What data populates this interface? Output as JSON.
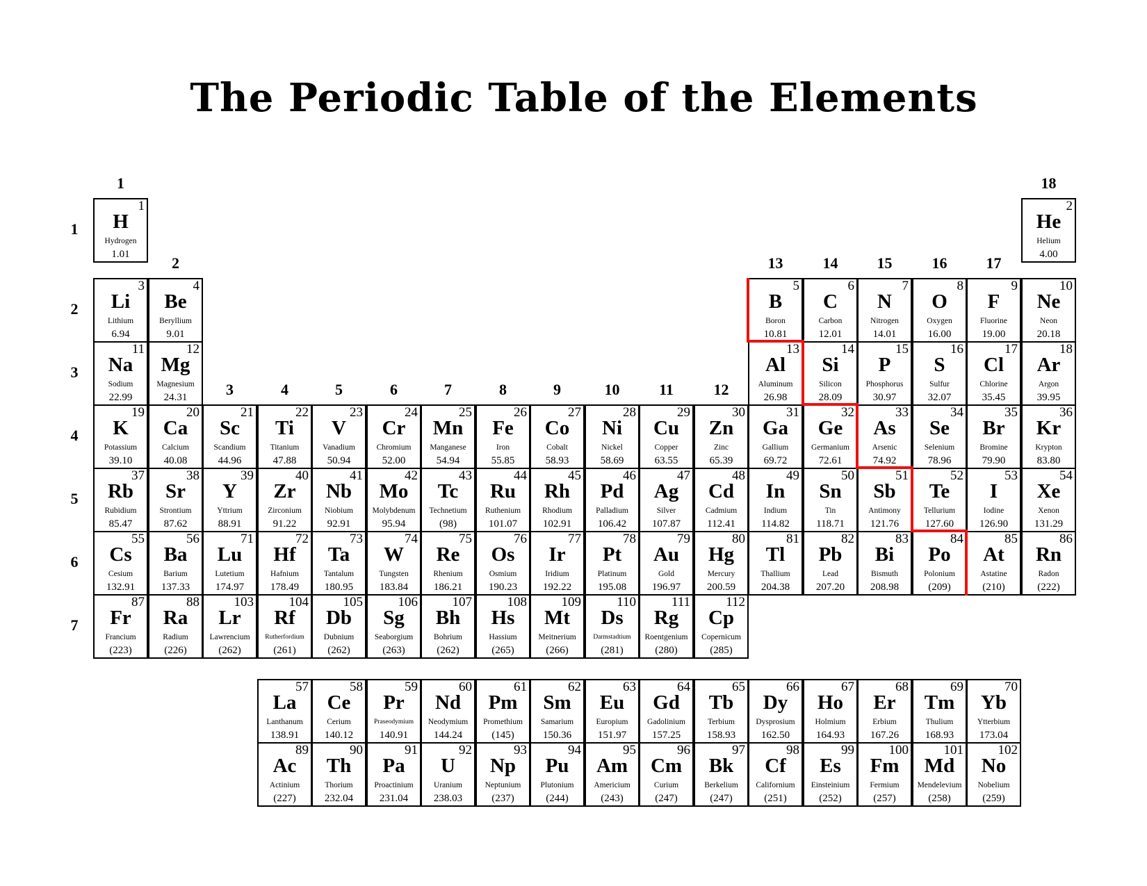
{
  "title": "The Periodic Table of the Elements",
  "colors": {
    "staircase_line": "#ee1111"
  },
  "group_labels": [
    "1",
    "2",
    "3",
    "4",
    "5",
    "6",
    "7",
    "8",
    "9",
    "10",
    "11",
    "12",
    "13",
    "14",
    "15",
    "16",
    "17",
    "18"
  ],
  "period_labels": [
    "1",
    "2",
    "3",
    "4",
    "5",
    "6",
    "7"
  ],
  "elements": [
    {
      "n": "1",
      "s": "H",
      "name": "Hydrogen",
      "w": "1.01"
    },
    {
      "n": "2",
      "s": "He",
      "name": "Helium",
      "w": "4.00"
    },
    {
      "n": "3",
      "s": "Li",
      "name": "Lithium",
      "w": "6.94"
    },
    {
      "n": "4",
      "s": "Be",
      "name": "Beryllium",
      "w": "9.01"
    },
    {
      "n": "5",
      "s": "B",
      "name": "Boron",
      "w": "10.81"
    },
    {
      "n": "6",
      "s": "C",
      "name": "Carbon",
      "w": "12.01"
    },
    {
      "n": "7",
      "s": "N",
      "name": "Nitrogen",
      "w": "14.01"
    },
    {
      "n": "8",
      "s": "O",
      "name": "Oxygen",
      "w": "16.00"
    },
    {
      "n": "9",
      "s": "F",
      "name": "Fluorine",
      "w": "19.00"
    },
    {
      "n": "10",
      "s": "Ne",
      "name": "Neon",
      "w": "20.18"
    },
    {
      "n": "11",
      "s": "Na",
      "name": "Sodium",
      "w": "22.99"
    },
    {
      "n": "12",
      "s": "Mg",
      "name": "Magnesium",
      "w": "24.31"
    },
    {
      "n": "13",
      "s": "Al",
      "name": "Aluminum",
      "w": "26.98"
    },
    {
      "n": "14",
      "s": "Si",
      "name": "Silicon",
      "w": "28.09"
    },
    {
      "n": "15",
      "s": "P",
      "name": "Phosphorus",
      "w": "30.97"
    },
    {
      "n": "16",
      "s": "S",
      "name": "Sulfur",
      "w": "32.07"
    },
    {
      "n": "17",
      "s": "Cl",
      "name": "Chlorine",
      "w": "35.45"
    },
    {
      "n": "18",
      "s": "Ar",
      "name": "Argon",
      "w": "39.95"
    },
    {
      "n": "19",
      "s": "K",
      "name": "Potassium",
      "w": "39.10"
    },
    {
      "n": "20",
      "s": "Ca",
      "name": "Calcium",
      "w": "40.08"
    },
    {
      "n": "21",
      "s": "Sc",
      "name": "Scandium",
      "w": "44.96"
    },
    {
      "n": "22",
      "s": "Ti",
      "name": "Titanium",
      "w": "47.88"
    },
    {
      "n": "23",
      "s": "V",
      "name": "Vanadium",
      "w": "50.94"
    },
    {
      "n": "24",
      "s": "Cr",
      "name": "Chromium",
      "w": "52.00"
    },
    {
      "n": "25",
      "s": "Mn",
      "name": "Manganese",
      "w": "54.94"
    },
    {
      "n": "26",
      "s": "Fe",
      "name": "Iron",
      "w": "55.85"
    },
    {
      "n": "27",
      "s": "Co",
      "name": "Cobalt",
      "w": "58.93"
    },
    {
      "n": "28",
      "s": "Ni",
      "name": "Nickel",
      "w": "58.69"
    },
    {
      "n": "29",
      "s": "Cu",
      "name": "Copper",
      "w": "63.55"
    },
    {
      "n": "30",
      "s": "Zn",
      "name": "Zinc",
      "w": "65.39"
    },
    {
      "n": "31",
      "s": "Ga",
      "name": "Gallium",
      "w": "69.72"
    },
    {
      "n": "32",
      "s": "Ge",
      "name": "Germanium",
      "w": "72.61"
    },
    {
      "n": "33",
      "s": "As",
      "name": "Arsenic",
      "w": "74.92"
    },
    {
      "n": "34",
      "s": "Se",
      "name": "Selenium",
      "w": "78.96"
    },
    {
      "n": "35",
      "s": "Br",
      "name": "Bromine",
      "w": "79.90"
    },
    {
      "n": "36",
      "s": "Kr",
      "name": "Krypton",
      "w": "83.80"
    },
    {
      "n": "37",
      "s": "Rb",
      "name": "Rubidium",
      "w": "85.47"
    },
    {
      "n": "38",
      "s": "Sr",
      "name": "Strontium",
      "w": "87.62"
    },
    {
      "n": "39",
      "s": "Y",
      "name": "Yttrium",
      "w": "88.91"
    },
    {
      "n": "40",
      "s": "Zr",
      "name": "Zirconium",
      "w": "91.22"
    },
    {
      "n": "41",
      "s": "Nb",
      "name": "Niobium",
      "w": "92.91"
    },
    {
      "n": "42",
      "s": "Mo",
      "name": "Molybdenum",
      "w": "95.94"
    },
    {
      "n": "43",
      "s": "Tc",
      "name": "Technetium",
      "w": "(98)"
    },
    {
      "n": "44",
      "s": "Ru",
      "name": "Ruthenium",
      "w": "101.07"
    },
    {
      "n": "45",
      "s": "Rh",
      "name": "Rhodium",
      "w": "102.91"
    },
    {
      "n": "46",
      "s": "Pd",
      "name": "Palladium",
      "w": "106.42"
    },
    {
      "n": "47",
      "s": "Ag",
      "name": "Silver",
      "w": "107.87"
    },
    {
      "n": "48",
      "s": "Cd",
      "name": "Cadmium",
      "w": "112.41"
    },
    {
      "n": "49",
      "s": "In",
      "name": "Indium",
      "w": "114.82"
    },
    {
      "n": "50",
      "s": "Sn",
      "name": "Tin",
      "w": "118.71"
    },
    {
      "n": "51",
      "s": "Sb",
      "name": "Antimony",
      "w": "121.76"
    },
    {
      "n": "52",
      "s": "Te",
      "name": "Tellurium",
      "w": "127.60"
    },
    {
      "n": "53",
      "s": "I",
      "name": "Iodine",
      "w": "126.90"
    },
    {
      "n": "54",
      "s": "Xe",
      "name": "Xenon",
      "w": "131.29"
    },
    {
      "n": "55",
      "s": "Cs",
      "name": "Cesium",
      "w": "132.91"
    },
    {
      "n": "56",
      "s": "Ba",
      "name": "Barium",
      "w": "137.33"
    },
    {
      "n": "71",
      "s": "Lu",
      "name": "Lutetium",
      "w": "174.97"
    },
    {
      "n": "72",
      "s": "Hf",
      "name": "Hafnium",
      "w": "178.49"
    },
    {
      "n": "73",
      "s": "Ta",
      "name": "Tantalum",
      "w": "180.95"
    },
    {
      "n": "74",
      "s": "W",
      "name": "Tungsten",
      "w": "183.84"
    },
    {
      "n": "75",
      "s": "Re",
      "name": "Rhenium",
      "w": "186.21"
    },
    {
      "n": "76",
      "s": "Os",
      "name": "Osmium",
      "w": "190.23"
    },
    {
      "n": "77",
      "s": "Ir",
      "name": "Iridium",
      "w": "192.22"
    },
    {
      "n": "78",
      "s": "Pt",
      "name": "Platinum",
      "w": "195.08"
    },
    {
      "n": "79",
      "s": "Au",
      "name": "Gold",
      "w": "196.97"
    },
    {
      "n": "80",
      "s": "Hg",
      "name": "Mercury",
      "w": "200.59"
    },
    {
      "n": "81",
      "s": "Tl",
      "name": "Thallium",
      "w": "204.38"
    },
    {
      "n": "82",
      "s": "Pb",
      "name": "Lead",
      "w": "207.20"
    },
    {
      "n": "83",
      "s": "Bi",
      "name": "Bismuth",
      "w": "208.98"
    },
    {
      "n": "84",
      "s": "Po",
      "name": "Polonium",
      "w": "(209)"
    },
    {
      "n": "85",
      "s": "At",
      "name": "Astatine",
      "w": "(210)"
    },
    {
      "n": "86",
      "s": "Rn",
      "name": "Radon",
      "w": "(222)"
    },
    {
      "n": "87",
      "s": "Fr",
      "name": "Francium",
      "w": "(223)"
    },
    {
      "n": "88",
      "s": "Ra",
      "name": "Radium",
      "w": "(226)"
    },
    {
      "n": "103",
      "s": "Lr",
      "name": "Lawrencium",
      "w": "(262)"
    },
    {
      "n": "104",
      "s": "Rf",
      "name": "Rutherfordium",
      "w": "(261)"
    },
    {
      "n": "105",
      "s": "Db",
      "name": "Dubnium",
      "w": "(262)"
    },
    {
      "n": "106",
      "s": "Sg",
      "name": "Seaborgium",
      "w": "(263)"
    },
    {
      "n": "107",
      "s": "Bh",
      "name": "Bohrium",
      "w": "(262)"
    },
    {
      "n": "108",
      "s": "Hs",
      "name": "Hassium",
      "w": "(265)"
    },
    {
      "n": "109",
      "s": "Mt",
      "name": "Meitnerium",
      "w": "(266)"
    },
    {
      "n": "110",
      "s": "Ds",
      "name": "Darmstadtium",
      "w": "(281)"
    },
    {
      "n": "111",
      "s": "Rg",
      "name": "Roentgenium",
      "w": "(280)"
    },
    {
      "n": "112",
      "s": "Cp",
      "name": "Copernicum",
      "w": "(285)"
    },
    {
      "n": "57",
      "s": "La",
      "name": "Lanthanum",
      "w": "138.91"
    },
    {
      "n": "58",
      "s": "Ce",
      "name": "Cerium",
      "w": "140.12"
    },
    {
      "n": "59",
      "s": "Pr",
      "name": "Praseodymium",
      "w": "140.91"
    },
    {
      "n": "60",
      "s": "Nd",
      "name": "Neodymium",
      "w": "144.24"
    },
    {
      "n": "61",
      "s": "Pm",
      "name": "Promethium",
      "w": "(145)"
    },
    {
      "n": "62",
      "s": "Sm",
      "name": "Samarium",
      "w": "150.36"
    },
    {
      "n": "63",
      "s": "Eu",
      "name": "Europium",
      "w": "151.97"
    },
    {
      "n": "64",
      "s": "Gd",
      "name": "Gadolinium",
      "w": "157.25"
    },
    {
      "n": "65",
      "s": "Tb",
      "name": "Terbium",
      "w": "158.93"
    },
    {
      "n": "66",
      "s": "Dy",
      "name": "Dysprosium",
      "w": "162.50"
    },
    {
      "n": "67",
      "s": "Ho",
      "name": "Holmium",
      "w": "164.93"
    },
    {
      "n": "68",
      "s": "Er",
      "name": "Erbium",
      "w": "167.26"
    },
    {
      "n": "69",
      "s": "Tm",
      "name": "Thulium",
      "w": "168.93"
    },
    {
      "n": "70",
      "s": "Yb",
      "name": "Ytterbium",
      "w": "173.04"
    },
    {
      "n": "89",
      "s": "Ac",
      "name": "Actinium",
      "w": "(227)"
    },
    {
      "n": "90",
      "s": "Th",
      "name": "Thorium",
      "w": "232.04"
    },
    {
      "n": "91",
      "s": "Pa",
      "name": "Proactinium",
      "w": "231.04"
    },
    {
      "n": "92",
      "s": "U",
      "name": "Uranium",
      "w": "238.03"
    },
    {
      "n": "93",
      "s": "Np",
      "name": "Neptunium",
      "w": "(237)"
    },
    {
      "n": "94",
      "s": "Pu",
      "name": "Plutonium",
      "w": "(244)"
    },
    {
      "n": "95",
      "s": "Am",
      "name": "Americium",
      "w": "(243)"
    },
    {
      "n": "96",
      "s": "Cm",
      "name": "Curium",
      "w": "(247)"
    },
    {
      "n": "97",
      "s": "Bk",
      "name": "Berkelium",
      "w": "(247)"
    },
    {
      "n": "98",
      "s": "Cf",
      "name": "Californium",
      "w": "(251)"
    },
    {
      "n": "99",
      "s": "Es",
      "name": "Einsteinium",
      "w": "(252)"
    },
    {
      "n": "100",
      "s": "Fm",
      "name": "Fermium",
      "w": "(257)"
    },
    {
      "n": "101",
      "s": "Md",
      "name": "Mendelevium",
      "w": "(258)"
    },
    {
      "n": "102",
      "s": "No",
      "name": "Nobelium",
      "w": "(259)"
    }
  ]
}
